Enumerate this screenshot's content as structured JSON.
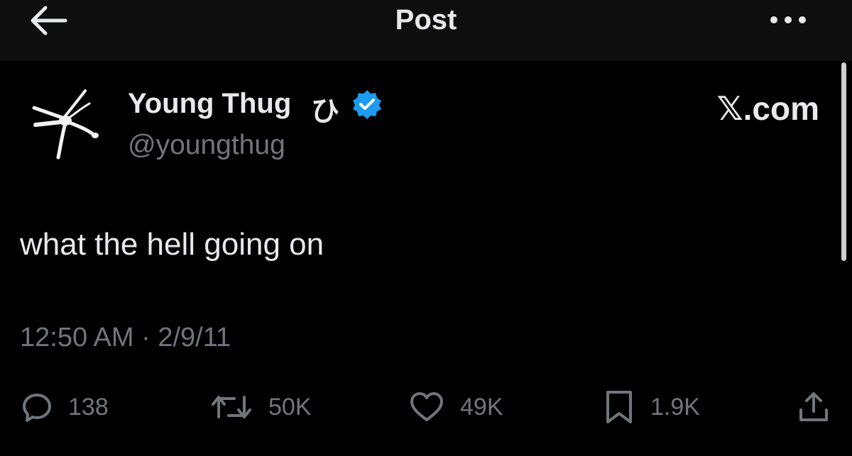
{
  "header": {
    "title": "Post",
    "back_icon": "arrow-left-icon",
    "more_icon": "more-dots-icon"
  },
  "author": {
    "display_name": "Young Thug",
    "name_symbol": "ひ",
    "handle": "@youngthug",
    "verified": true,
    "verified_color": "#1d9bf0",
    "avatar_icon": "spider-logo-avatar"
  },
  "brand_label": "𝕏.com",
  "post": {
    "text": "what the hell going on",
    "timestamp": "12:50 AM · 2/9/11"
  },
  "actions": {
    "replies": "138",
    "reposts": "50K",
    "likes": "49K",
    "bookmarks": "1.9K",
    "icons": [
      "reply-icon",
      "repost-icon",
      "like-icon",
      "bookmark-icon",
      "share-icon"
    ]
  },
  "colors": {
    "background": "#000000",
    "topbar": "#0e0e0e",
    "text_primary": "#e7e9ea",
    "text_secondary": "#71767b"
  }
}
